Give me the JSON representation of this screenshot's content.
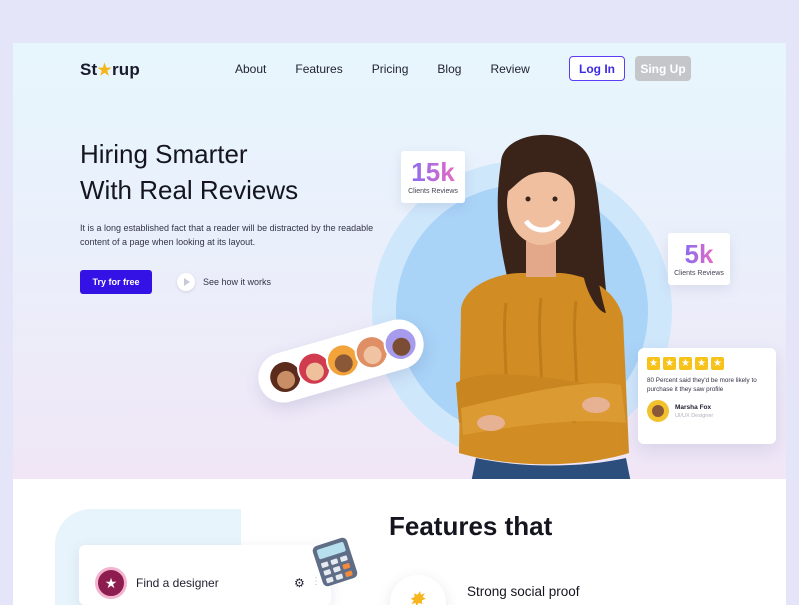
{
  "brand": {
    "logo_before": "St",
    "logo_after": "rup",
    "logo_icon": "star-icon"
  },
  "nav": {
    "items": [
      "About",
      "Features",
      "Pricing",
      "Blog",
      "Review"
    ],
    "login_label": "Log In",
    "signup_label": "Sing Up"
  },
  "hero": {
    "title_line1": "Hiring Smarter",
    "title_line2": "With Real Reviews",
    "description": "It is a long established fact that a reader will be distracted by the readable content of a page when looking at its layout.",
    "cta_primary": "Try for free",
    "cta_secondary": "See how it works"
  },
  "stats": [
    {
      "value": "15k",
      "label": "Clients Reviews"
    },
    {
      "value": "5k",
      "label": "Clients Reviews"
    }
  ],
  "review_card": {
    "rating": 5,
    "text": "80 Percent said they'd be more likely to purchase it they saw profile",
    "author": "Marsha Fox",
    "role": "UI/UX Designer"
  },
  "features": {
    "title": "Features that",
    "card_label": "Find a designer",
    "item_label": "Strong social proof"
  },
  "colors": {
    "accent": "#3411e4",
    "star": "#f7c21a",
    "sweater": "#d18d24"
  }
}
